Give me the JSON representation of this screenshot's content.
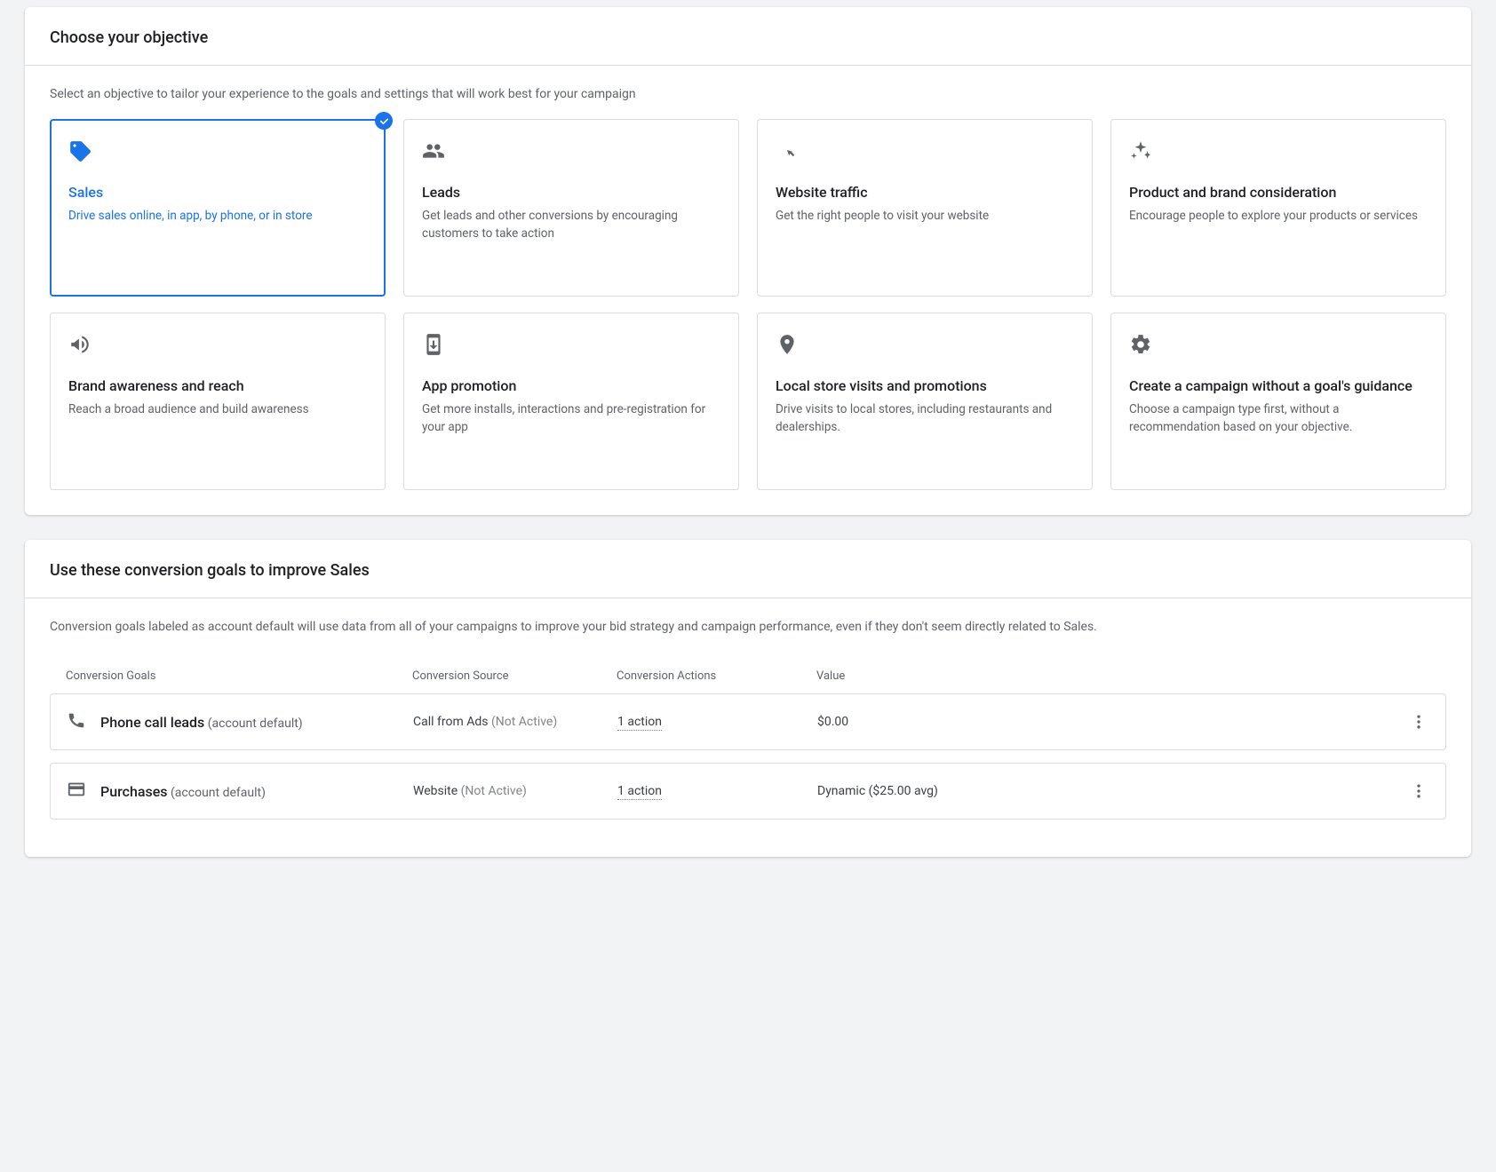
{
  "objective_panel": {
    "heading": "Choose your objective",
    "subtext": "Select an objective to tailor your experience to the goals and settings that will work best for your campaign",
    "cards": [
      {
        "title": "Sales",
        "desc": "Drive sales online, in app, by phone, or in store",
        "selected": true
      },
      {
        "title": "Leads",
        "desc": "Get leads and other conversions by encouraging customers to take action",
        "selected": false
      },
      {
        "title": "Website traffic",
        "desc": "Get the right people to visit your website",
        "selected": false
      },
      {
        "title": "Product and brand consideration",
        "desc": "Encourage people to explore your products or services",
        "selected": false
      },
      {
        "title": "Brand awareness and reach",
        "desc": "Reach a broad audience and build awareness",
        "selected": false
      },
      {
        "title": "App promotion",
        "desc": "Get more installs, interactions and pre-registration for your app",
        "selected": false
      },
      {
        "title": "Local store visits and promotions",
        "desc": "Drive visits to local stores, including restaurants and dealerships.",
        "selected": false
      },
      {
        "title": "Create a campaign without a goal's guidance",
        "desc": "Choose a campaign type first, without a recommendation based on your objective.",
        "selected": false
      }
    ]
  },
  "goals_panel": {
    "heading": "Use these conversion goals to improve Sales",
    "subtext": "Conversion goals labeled as account default will use data from all of your campaigns to improve your bid strategy and campaign performance, even if they don't seem directly related to Sales.",
    "columns": {
      "goals": "Conversion Goals",
      "source": "Conversion Source",
      "actions": "Conversion Actions",
      "value": "Value"
    },
    "rows": [
      {
        "name": "Phone call leads",
        "default_label": "(account default)",
        "source": "Call from Ads",
        "source_status": "(Not Active)",
        "actions": "1 action",
        "value": "$0.00"
      },
      {
        "name": "Purchases",
        "default_label": "(account default)",
        "source": "Website",
        "source_status": "(Not Active)",
        "actions": "1 action",
        "value": "Dynamic ($25.00 avg)"
      }
    ]
  }
}
